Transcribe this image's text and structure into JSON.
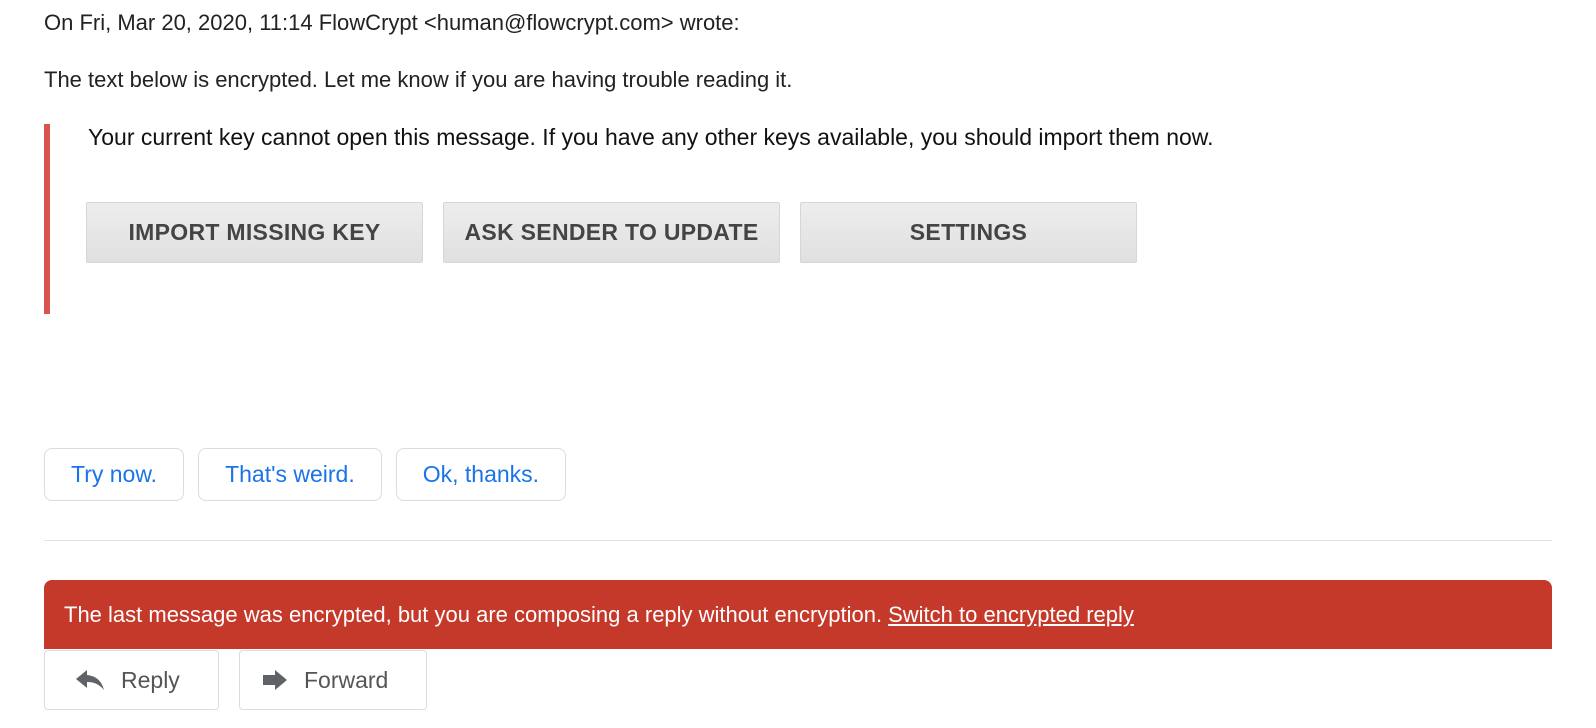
{
  "quote": {
    "header": "On Fri, Mar 20, 2020, 11:14 FlowCrypt <human@flowcrypt.com> wrote:",
    "intro": "The text below is encrypted. Let me know if you are having trouble reading it."
  },
  "flowcrypt_block": {
    "message": "Your current key cannot open this message. If you have any other keys available, you should import them now.",
    "accent_color": "#d9534f",
    "buttons": [
      {
        "label": "IMPORT MISSING KEY"
      },
      {
        "label": "ASK SENDER TO UPDATE"
      },
      {
        "label": "SETTINGS"
      }
    ]
  },
  "smart_replies": [
    {
      "label": "Try now."
    },
    {
      "label": "That's weird."
    },
    {
      "label": "Ok, thanks."
    }
  ],
  "warning": {
    "text": "The last message was encrypted, but you are composing a reply without encryption.",
    "link": "Switch to encrypted reply",
    "color": "#c5392b"
  },
  "actions": {
    "reply": {
      "label": "Reply",
      "icon": "reply-icon"
    },
    "forward": {
      "label": "Forward",
      "icon": "forward-icon"
    }
  }
}
